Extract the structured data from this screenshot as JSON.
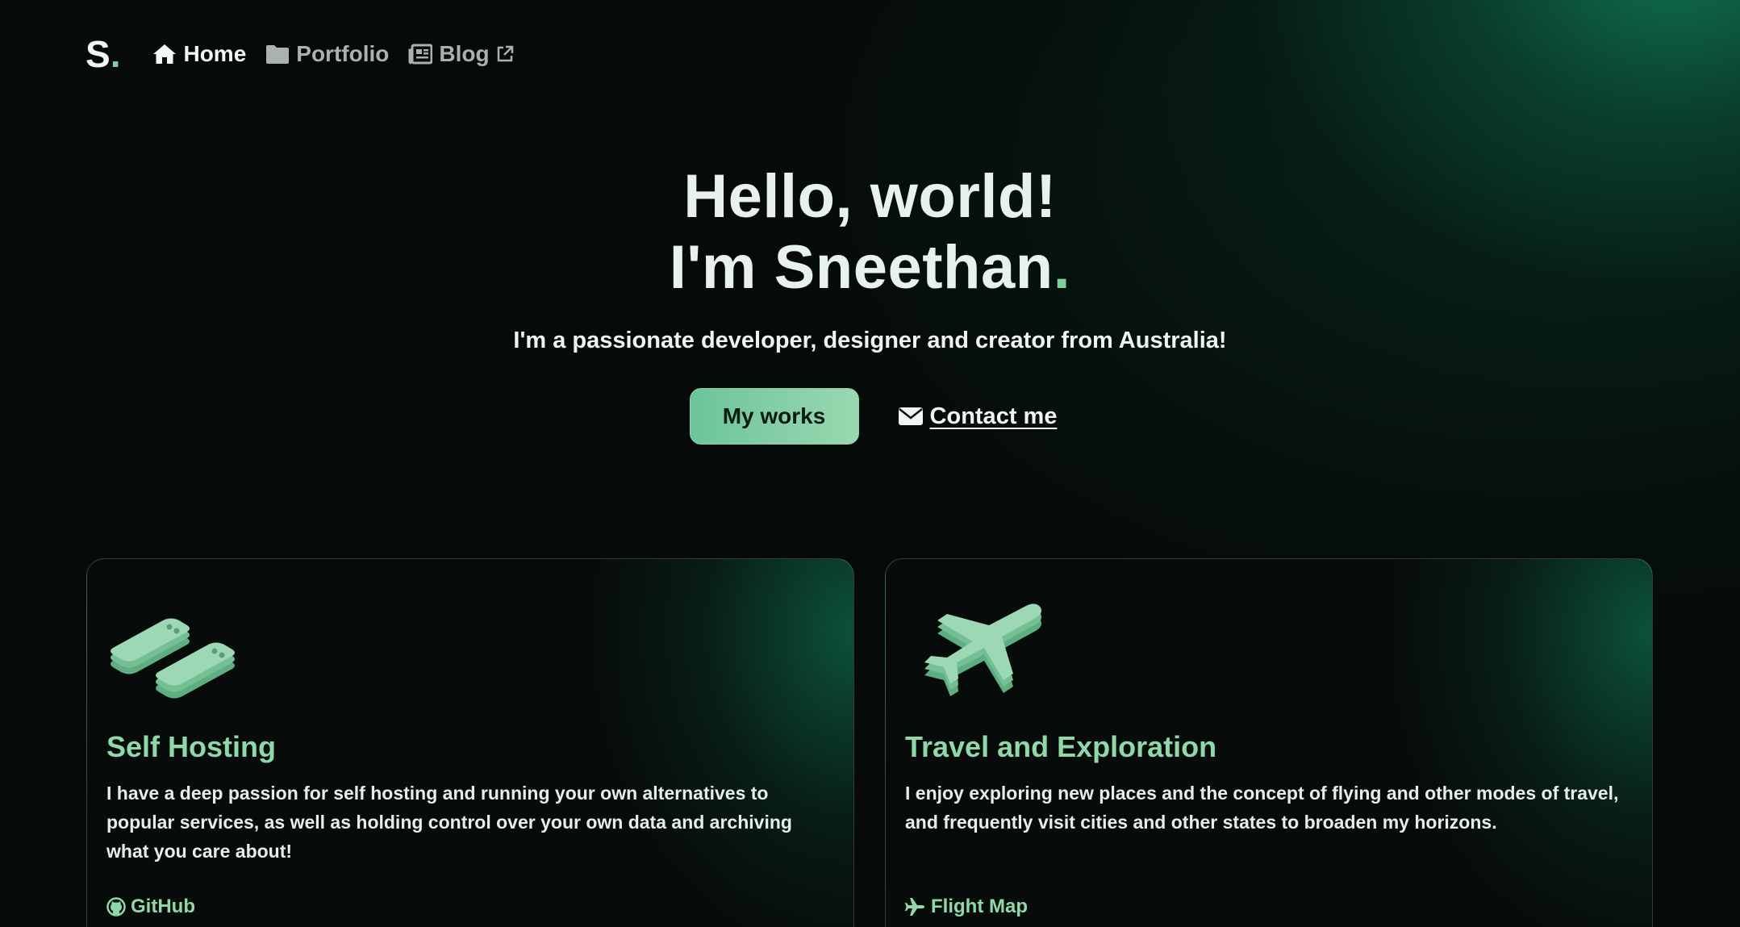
{
  "nav": {
    "logo_letter": "S",
    "logo_dot": ".",
    "items": [
      {
        "label": "Home",
        "icon": "home-icon",
        "active": true
      },
      {
        "label": "Portfolio",
        "icon": "folder-icon",
        "active": false
      },
      {
        "label": "Blog",
        "icon": "newspaper-icon",
        "external": true,
        "active": false
      }
    ]
  },
  "hero": {
    "line1": "Hello, world!",
    "line2": "I'm Sneethan",
    "line2_dot": ".",
    "subtitle": "I'm a passionate developer, designer and creator from Australia!",
    "primary_button": "My works",
    "contact_link": "Contact me"
  },
  "cards": [
    {
      "icon": "server-icon",
      "title": "Self Hosting",
      "text": "I have a deep passion for self hosting and running your own alternatives to popular services, as well as holding control over your own data and archiving what you care about!",
      "link_icon": "github-icon",
      "link_label": "GitHub"
    },
    {
      "icon": "airplane-icon",
      "title": "Travel and Exploration",
      "text": "I enjoy exploring new places and the concept of flying and other modes of travel, and frequently visit cities and other states to broaden my horizons.",
      "link_icon": "plane-icon",
      "link_label": "Flight Map"
    }
  ],
  "colors": {
    "accent": "#7fcf9f",
    "background": "#060a08",
    "glow": "#12825f",
    "card_title": "#8fd8aa"
  }
}
